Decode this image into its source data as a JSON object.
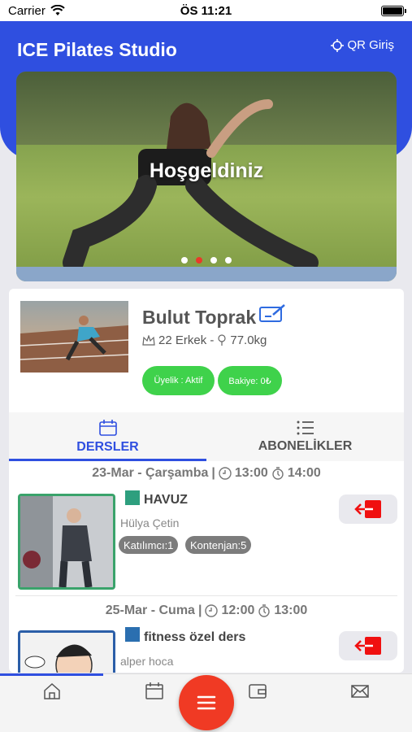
{
  "status_bar": {
    "carrier": "Carrier",
    "time": "ÖS 11:21"
  },
  "header": {
    "title": "ICE Pilates Studio",
    "qr_label": "QR Giriş"
  },
  "banner": {
    "caption": "Hoşgeldiniz",
    "slides": 4,
    "active_slide": 2
  },
  "profile": {
    "name": "Bulut Toprak",
    "details": "22 Erkek - ",
    "weight": "77.0kg",
    "membership": "Üyelik : Aktif",
    "balance": "Bakiye: 0₺"
  },
  "tabs": [
    {
      "label": "DERSLER",
      "icon": "calendar-icon",
      "active": true
    },
    {
      "label": "ABONELİKLER",
      "icon": "list-icon",
      "active": false
    }
  ],
  "lessons": [
    {
      "date": "23-Mar - Çarşamba",
      "start": "13:00",
      "end": "14:00",
      "name": "HAVUZ",
      "color": "#2e9f7e",
      "teacher": "Hülya Çetin",
      "participants": "Katılımcı:1",
      "quota": "Kontenjan:5"
    },
    {
      "date": "25-Mar - Cuma",
      "start": "12:00",
      "end": "13:00",
      "name": "fitness özel ders",
      "color": "#2b6fb0",
      "teacher": "alper hoca"
    }
  ],
  "bottom_nav": [
    "home-icon",
    "calendar-icon",
    "menu-icon",
    "wallet-icon",
    "mail-icon"
  ]
}
